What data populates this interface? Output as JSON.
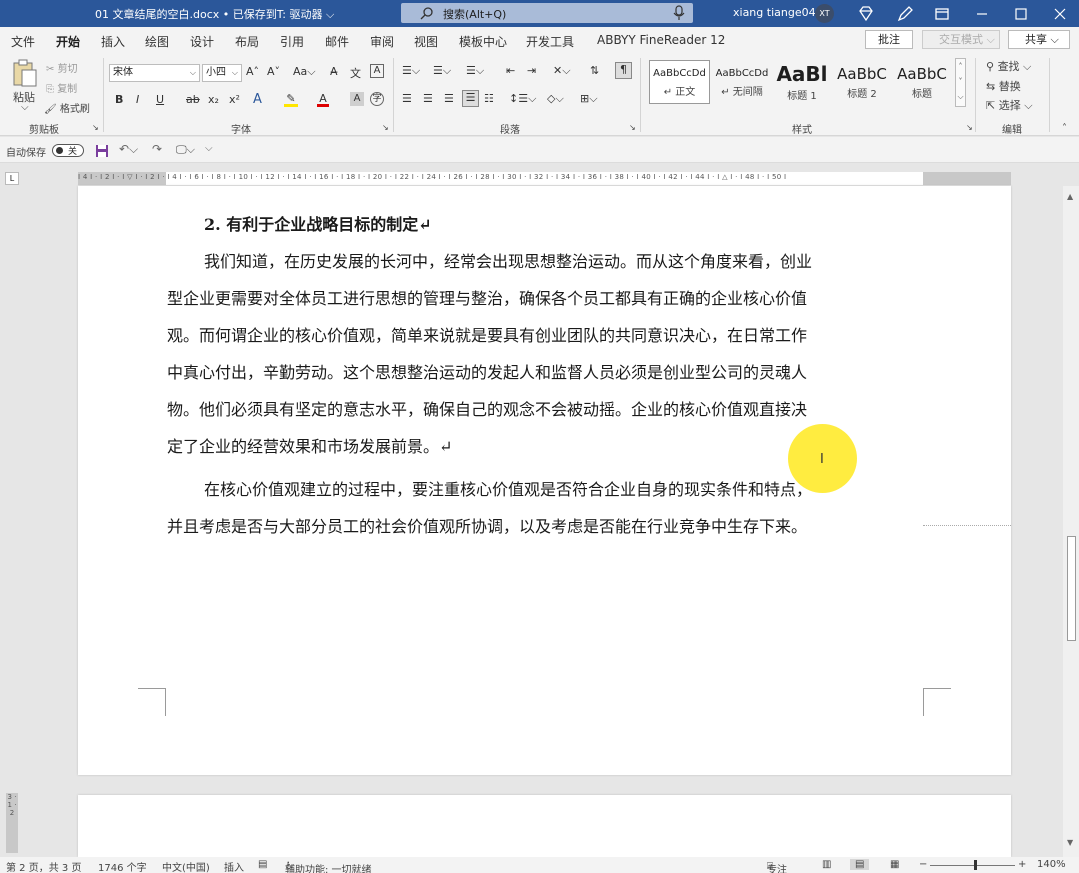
{
  "window": {
    "title": "01 文章结尾的空白.docx • 已保存到T: 驱动器 ⌵",
    "search_placeholder": "搜索(Alt+Q)",
    "user_name": "xiang tiange04",
    "user_initials": "XT"
  },
  "tabs": [
    "文件",
    "开始",
    "插入",
    "绘图",
    "设计",
    "布局",
    "引用",
    "邮件",
    "审阅",
    "视图",
    "模板中心",
    "开发工具",
    "ABBYY FineReader 12"
  ],
  "tab_actions": {
    "comment": "批注",
    "track": "交互模式",
    "share": "共享"
  },
  "ribbon": {
    "clipboard": {
      "paste": "粘贴",
      "cut": "剪切",
      "copy": "复制",
      "format_painter": "格式刷",
      "label": "剪贴板"
    },
    "font": {
      "name": "宋体",
      "size": "小四",
      "label": "字体",
      "grow": "A^",
      "shrink": "A˅",
      "case": "Aa",
      "bold": "B",
      "italic": "I",
      "underline": "U",
      "strike": "ab",
      "sub": "x₂",
      "sup": "x²"
    },
    "paragraph": {
      "label": "段落"
    },
    "styles": {
      "label": "样式",
      "items": [
        {
          "sample": "AaBbCcDd",
          "name": "↵ 正文"
        },
        {
          "sample": "AaBbCcDd",
          "name": "↵ 无间隔"
        },
        {
          "sample": "AaBl",
          "name": "标题 1"
        },
        {
          "sample": "AaBbC",
          "name": "标题 2"
        },
        {
          "sample": "AaBbC",
          "name": "标题"
        }
      ]
    },
    "editing": {
      "find": "查找",
      "replace": "替换",
      "select": "选择",
      "label": "编辑"
    }
  },
  "qat": {
    "autosave": "自动保存",
    "toggle": "关"
  },
  "ruler_ticks": "I 4 I · I 2 I · I ▽ I · I 2 I · I 4 I · I 6 I · I 8 I · I 10 I · I 12 I · I 14 I · I 16 I · I 18 I · I 20 I · I 22 I · I 24 I · I 26 I · I 28 I · I 30 I · I 32 I · I 34 I · I 36 I · I 38 I · I 40 I · I 42 I · I 44 I · I △ I · I 48 I · I 50 I",
  "vruler_ticks": "3 · 1 · 2",
  "document": {
    "heading": "2. 有利于企业战略目标的制定↵",
    "para1_lines": [
      "我们知道，在历史发展的长河中，经常会出现思想整治运动。而从这个角度来看，创业",
      "型企业更需要对全体员工进行思想的管理与整治，确保各个员工都具有正确的企业核心价值",
      "观。而何谓企业的核心价值观，简单来说就是要具有创业团队的共同意识决心，在日常工作",
      "中真心付出，辛勤劳动。这个思想整治运动的发起人和监督人员必须是创业型公司的灵魂人",
      "物。他们必须具有坚定的意志水平，确保自己的观念不会被动摇。企业的核心价值观直接决",
      "定了企业的经营效果和市场发展前景。↵"
    ],
    "para2_lines": [
      "在核心价值观建立的过程中，要注重核心价值观是否符合企业自身的现实条件和特点，",
      "并且考虑是否与大部分员工的社会价值观所协调，以及考虑是否能在行业竞争中生存下来。"
    ]
  },
  "statusbar": {
    "page": "第 2 页，共 3 页",
    "words": "1746 个字",
    "language": "中文(中国)",
    "mode": "插入",
    "accessibility": "辅助功能: 一切就绪",
    "focus": "专注",
    "zoom": "140%"
  }
}
